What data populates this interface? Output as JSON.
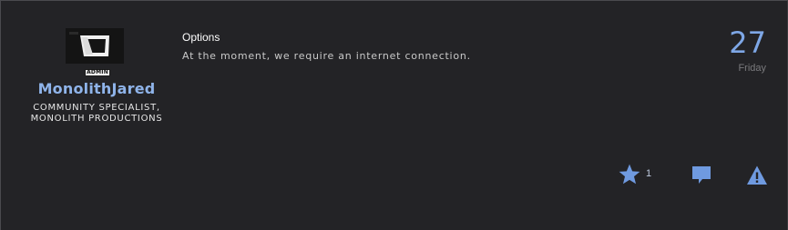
{
  "author": {
    "badge": "ADMIN",
    "username": "MonolithJared",
    "title": "COMMUNITY SPECIALIST, MONOLITH PRODUCTIONS"
  },
  "post": {
    "title": "Options",
    "body": "At the moment, we require an internet connection."
  },
  "date": {
    "day": "27",
    "weekday": "Friday"
  },
  "actions": {
    "like_count": "1",
    "like_icon": "star-icon",
    "reply_icon": "speech-bubble-icon",
    "report_icon": "warning-icon"
  },
  "colors": {
    "background": "#232326",
    "accent": "#7ea7e6",
    "username": "#8fb4ea"
  }
}
